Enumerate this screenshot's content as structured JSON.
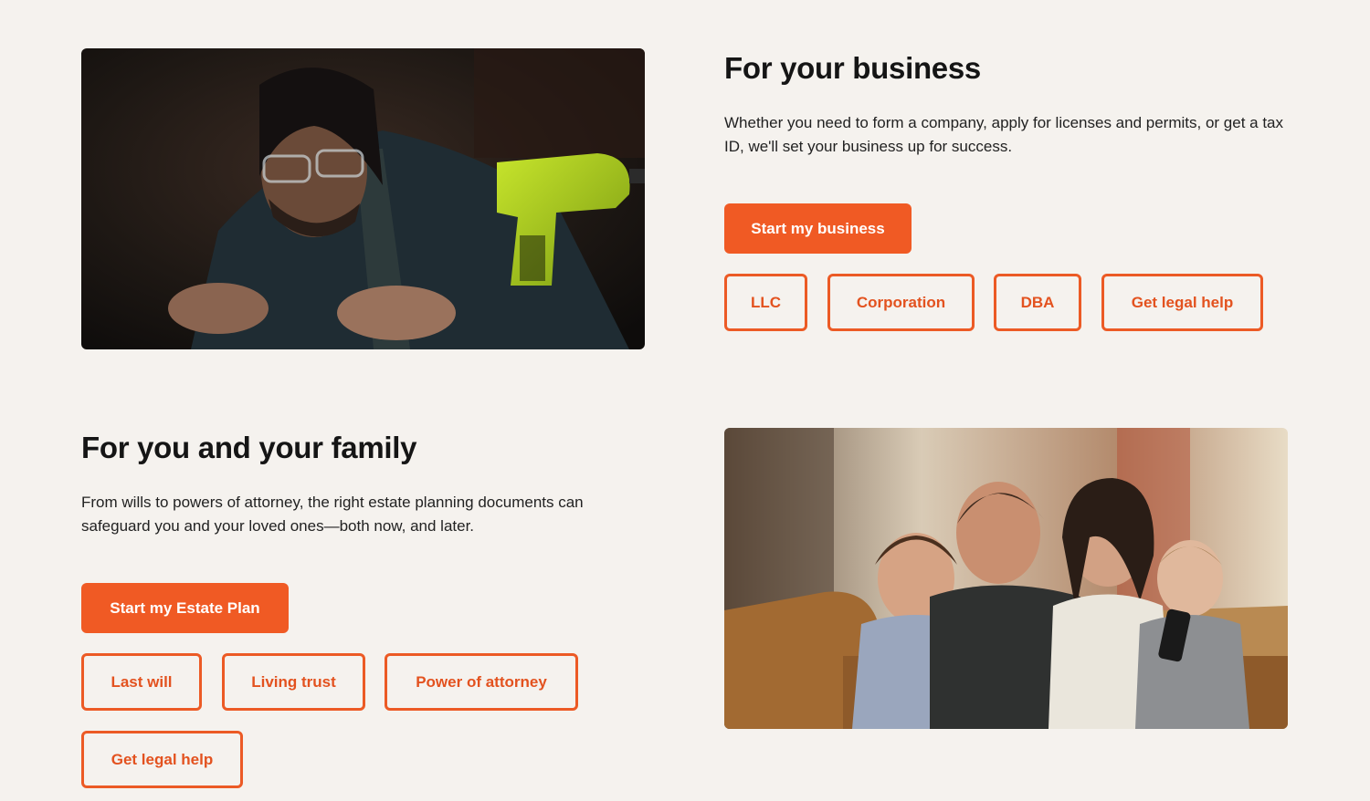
{
  "business": {
    "heading": "For your business",
    "description": "Whether you need to form a company, apply for licenses and permits, or get a tax ID, we'll set your business up for success.",
    "primary_cta": "Start my business",
    "chips": [
      "LLC",
      "Corporation",
      "DBA",
      "Get legal help"
    ],
    "photo": "man-with-power-drill-photo"
  },
  "family": {
    "heading": "For you and your family",
    "description": "From wills to powers of attorney, the right estate planning documents can safeguard you and your loved ones—both now, and later.",
    "primary_cta": "Start my Estate Plan",
    "chips": [
      "Last will",
      "Living trust",
      "Power of attorney",
      "Get legal help"
    ],
    "photo": "family-on-couch-photo"
  },
  "colors": {
    "accent": "#f05a24",
    "chip_border": "#ec5a25",
    "background": "#f5f2ee",
    "text": "#1a1a1a"
  }
}
